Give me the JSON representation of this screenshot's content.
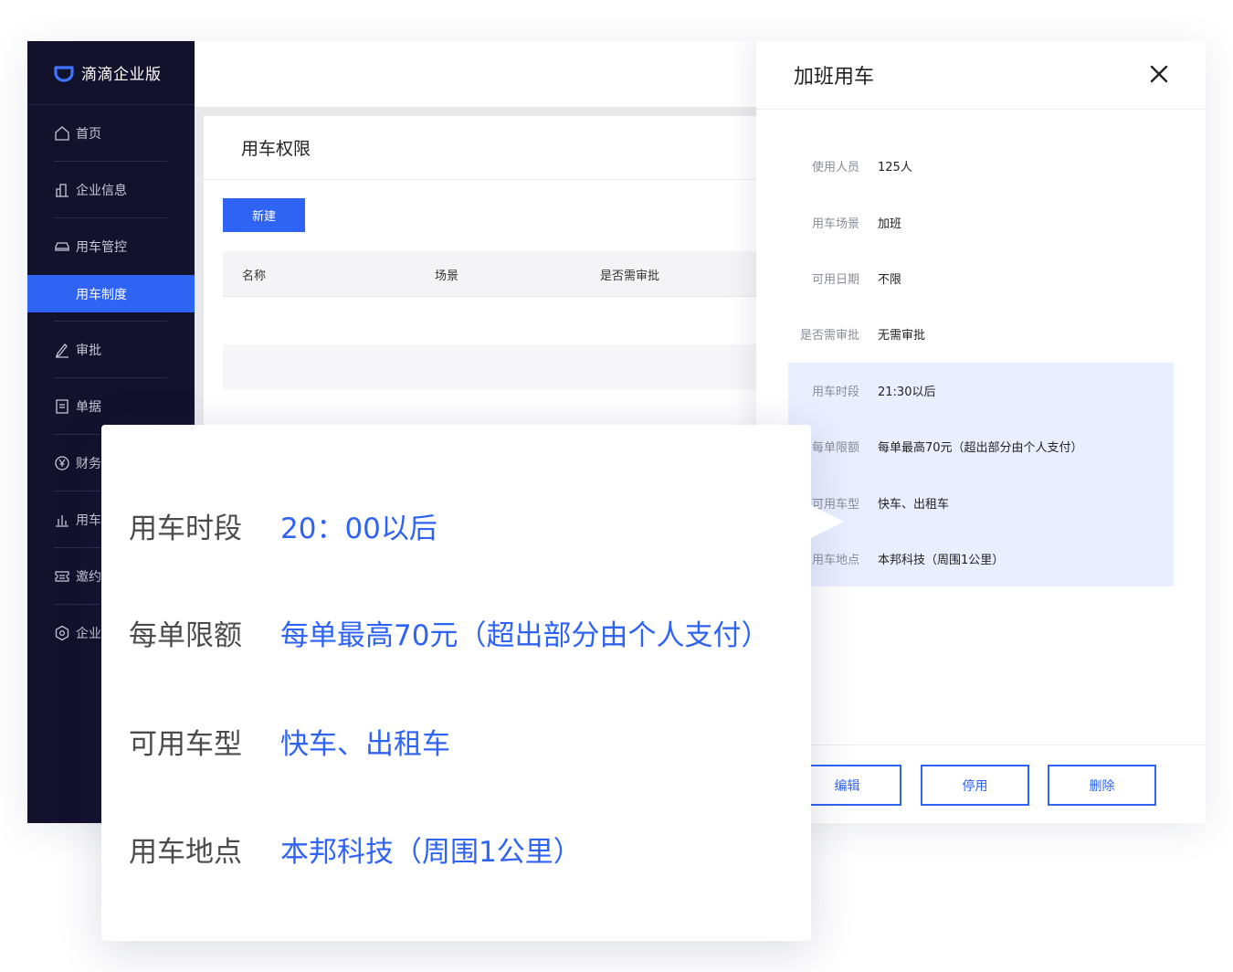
{
  "brand": {
    "name": "滴滴企业版"
  },
  "sidebar": {
    "items": [
      {
        "label": "首页",
        "icon": "home-icon"
      },
      {
        "label": "企业信息",
        "icon": "enterprise-info-icon"
      },
      {
        "label": "用车管控",
        "icon": "car-icon"
      },
      {
        "label": "用车制度",
        "active": true
      },
      {
        "label": "审批",
        "icon": "pen-icon"
      },
      {
        "label": "单据",
        "icon": "document-icon"
      },
      {
        "label": "财务",
        "icon": "yuan-icon"
      },
      {
        "label": "用车",
        "icon": "bar-chart-icon"
      },
      {
        "label": "邀约",
        "icon": "ticket-icon"
      },
      {
        "label": "企业",
        "icon": "settings-hex-icon"
      }
    ]
  },
  "content": {
    "title": "用车权限",
    "new_button": "新建",
    "columns": [
      "名称",
      "场景",
      "是否需审批"
    ]
  },
  "drawer": {
    "title": "加班用车",
    "details": [
      {
        "label": "使用人员",
        "value": "125人"
      },
      {
        "label": "用车场景",
        "value": "加班"
      },
      {
        "label": "可用日期",
        "value": "不限"
      },
      {
        "label": "是否需审批",
        "value": "无需审批"
      },
      {
        "label": "用车时段",
        "value": "21:30以后"
      },
      {
        "label": "每单限额",
        "value": "每单最高70元（超出部分由个人支付）"
      },
      {
        "label": "可用车型",
        "value": "快车、出租车"
      },
      {
        "label": "用车地点",
        "value": "本邦科技（周围1公里）"
      }
    ],
    "buttons": {
      "edit": "编辑",
      "disable": "停用",
      "delete": "删除"
    }
  },
  "overlay": {
    "rows": [
      {
        "label": "用车时段",
        "value": "20：00以后"
      },
      {
        "label": "每单限额",
        "value": "每单最高70元（超出部分由个人支付）"
      },
      {
        "label": "可用车型",
        "value": "快车、出租车"
      },
      {
        "label": "用车地点",
        "value": "本邦科技（周围1公里）"
      }
    ]
  },
  "colors": {
    "sidebar_bg": "#13122d",
    "accent": "#2f63f4",
    "highlight_bg": "#e9efff"
  }
}
